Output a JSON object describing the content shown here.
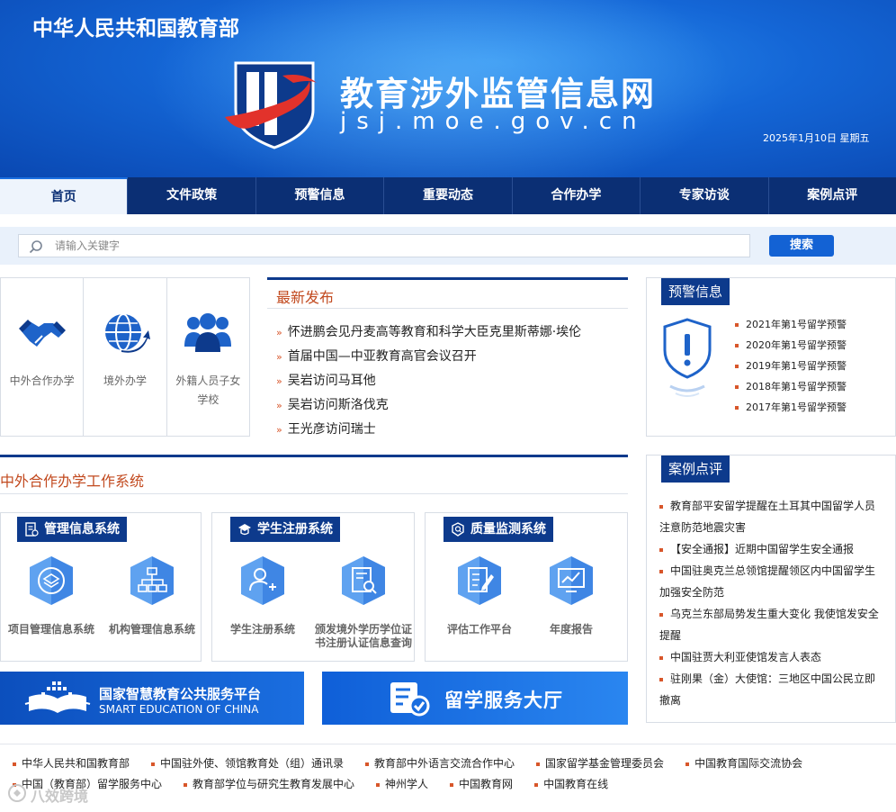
{
  "header": {
    "ministry": "中华人民共和国教育部",
    "site_title": "教育涉外监管信息网",
    "site_domain": "jsj.moe.gov.cn",
    "date": "2025年1月10日  星期五"
  },
  "nav": {
    "items": [
      {
        "label": "首页"
      },
      {
        "label": "文件政策"
      },
      {
        "label": "预警信息"
      },
      {
        "label": "重要动态"
      },
      {
        "label": "合作办学"
      },
      {
        "label": "专家访谈"
      },
      {
        "label": "案例点评"
      }
    ]
  },
  "search": {
    "placeholder": "请输入关键字",
    "button": "搜索"
  },
  "quick_links": [
    {
      "label": "中外合作办学",
      "icon": "handshake-icon"
    },
    {
      "label": "境外办学",
      "icon": "globe-arrow-icon"
    },
    {
      "label": "外籍人员子女学校",
      "icon": "group-people-icon"
    }
  ],
  "latest": {
    "title": "最新发布",
    "items": [
      "怀进鹏会见丹麦高等教育和科学大臣克里斯蒂娜·埃伦",
      "首届中国—中亚教育高官会议召开",
      "吴岩访问马耳他",
      "吴岩访问斯洛伐克",
      "王光彦访问瑞士"
    ]
  },
  "warning": {
    "title": "预警信息",
    "items": [
      "2021年第1号留学预警",
      "2020年第1号留学预警",
      "2019年第1号留学预警",
      "2018年第1号留学预警",
      "2017年第1号留学预警"
    ]
  },
  "systems": {
    "title": "中外合作办学工作系统",
    "panels": [
      {
        "title": "管理信息系统",
        "items": [
          {
            "label": "项目管理信息系统"
          },
          {
            "label": "机构管理信息系统"
          }
        ]
      },
      {
        "title": "学生注册系统",
        "items": [
          {
            "label": "学生注册系统"
          },
          {
            "label": "颁发境外学历学位证书注册认证信息查询"
          }
        ]
      },
      {
        "title": "质量监测系统",
        "items": [
          {
            "label": "评估工作平台"
          },
          {
            "label": "年度报告"
          }
        ]
      }
    ]
  },
  "banners": {
    "smart_edu_cn": "国家智慧教育公共服务平台",
    "smart_edu_en": "SMART EDUCATION OF CHINA",
    "study_abroad": "留学服务大厅"
  },
  "cases": {
    "title": "案例点评",
    "items": [
      "教育部平安留学提醒在土耳其中国留学人员注意防范地震灾害",
      "【安全通报】近期中国留学生安全通报",
      "中国驻奥克兰总领馆提醒领区内中国留学生加强安全防范",
      "乌克兰东部局势发生重大变化 我使馆发安全提醒",
      "中国驻贾大利亚使馆发言人表态",
      "驻刚果（金）大使馆：三地区中国公民立即撤离"
    ]
  },
  "footer": {
    "links": [
      "中华人民共和国教育部",
      "中国驻外使、领馆教育处（组）通讯录",
      "教育部中外语言交流合作中心",
      "国家留学基金管理委员会",
      "中国教育国际交流协会",
      "中国（教育部）留学服务中心",
      "教育部学位与研究生教育发展中心",
      "神州学人",
      "中国教育网",
      "中国教育在线"
    ],
    "watermark": "八效跨境"
  },
  "colors": {
    "header_blue": "#1466d6",
    "nav_navy": "#0b2f74",
    "accent_orange": "#c24a1f",
    "bullet_orange": "#d8562a",
    "button_blue": "#1362d4"
  }
}
